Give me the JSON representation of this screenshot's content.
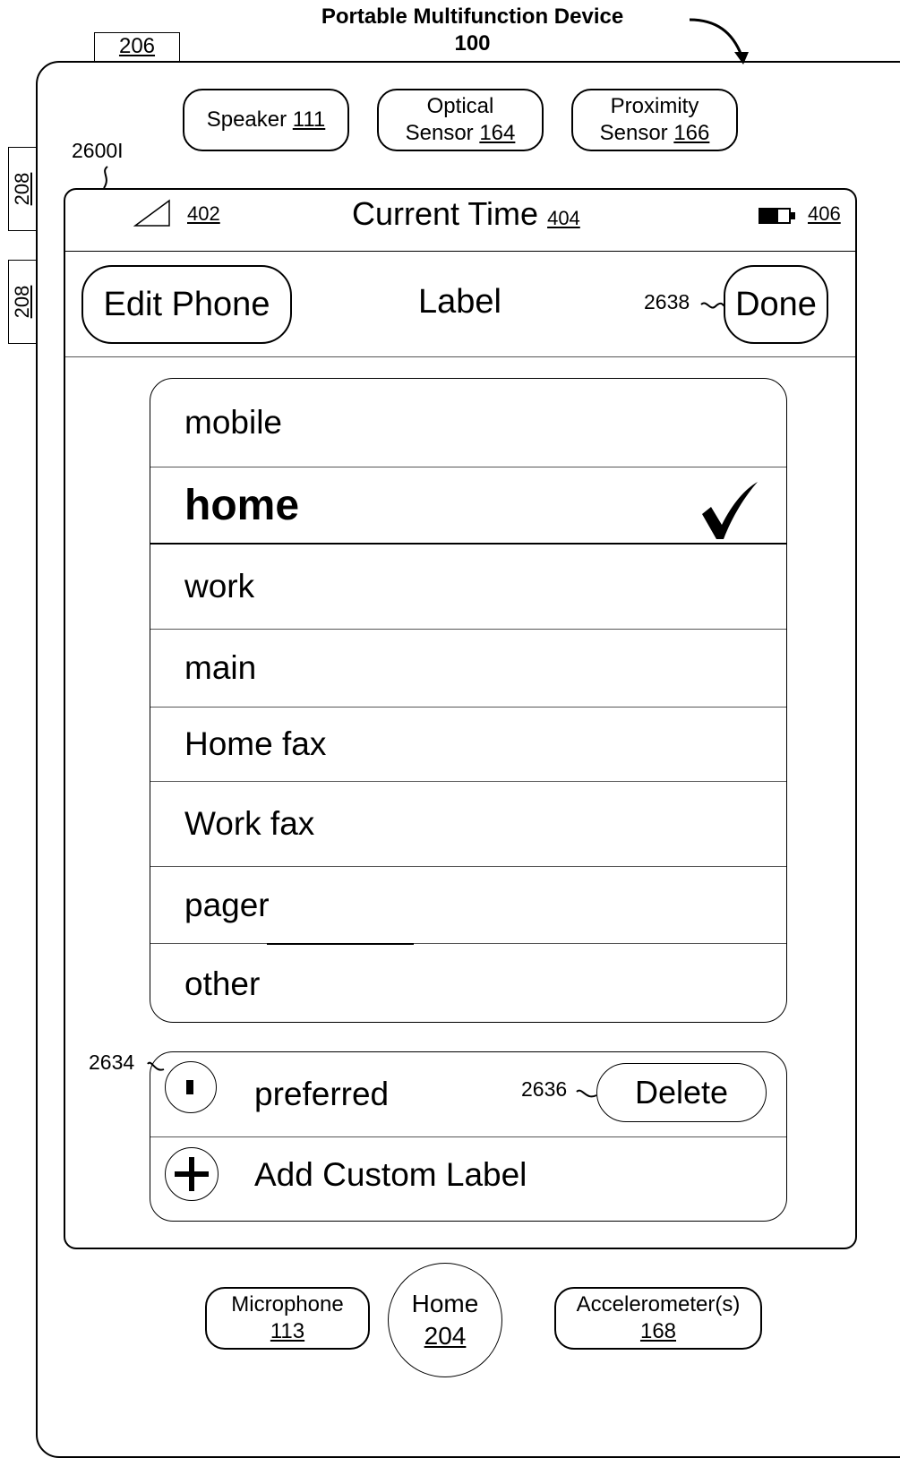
{
  "device": {
    "title_line1": "Portable Multifunction Device",
    "title_line2": "100",
    "ref_206": "206",
    "ref_208_a": "208",
    "ref_208_b": "208"
  },
  "top_components": [
    {
      "label": "Speaker",
      "ref": "111"
    },
    {
      "label_line1": "Optical",
      "label_line2": "Sensor",
      "ref": "164"
    },
    {
      "label_line1": "Proximity",
      "label_line2": "Sensor",
      "ref": "166"
    }
  ],
  "screen": {
    "ref": "2600I",
    "status_bar": {
      "signal_ref": "402",
      "time_label": "Current Time",
      "time_ref": "404",
      "battery_ref": "406"
    },
    "nav": {
      "back_label": "Edit Phone",
      "title": "Label",
      "done_ref": "2638",
      "done_label": "Done"
    },
    "labels": [
      {
        "text": "mobile",
        "selected": false
      },
      {
        "text": "home",
        "selected": true
      },
      {
        "text": "work",
        "selected": false
      },
      {
        "text": "main",
        "selected": false
      },
      {
        "text": "Home fax",
        "selected": false
      },
      {
        "text": "Work fax",
        "selected": false
      },
      {
        "text": "pager",
        "selected": false
      },
      {
        "text": "other",
        "selected": false
      }
    ],
    "custom": {
      "minus_ref": "2634",
      "preferred_label": "preferred",
      "delete_ref": "2636",
      "delete_label": "Delete",
      "add_label": "Add Custom Label"
    }
  },
  "bottom_components": [
    {
      "label": "Microphone",
      "ref": "113"
    },
    {
      "label": "Home",
      "ref": "204"
    },
    {
      "label": "Accelerometer(s)",
      "ref": "168"
    }
  ]
}
